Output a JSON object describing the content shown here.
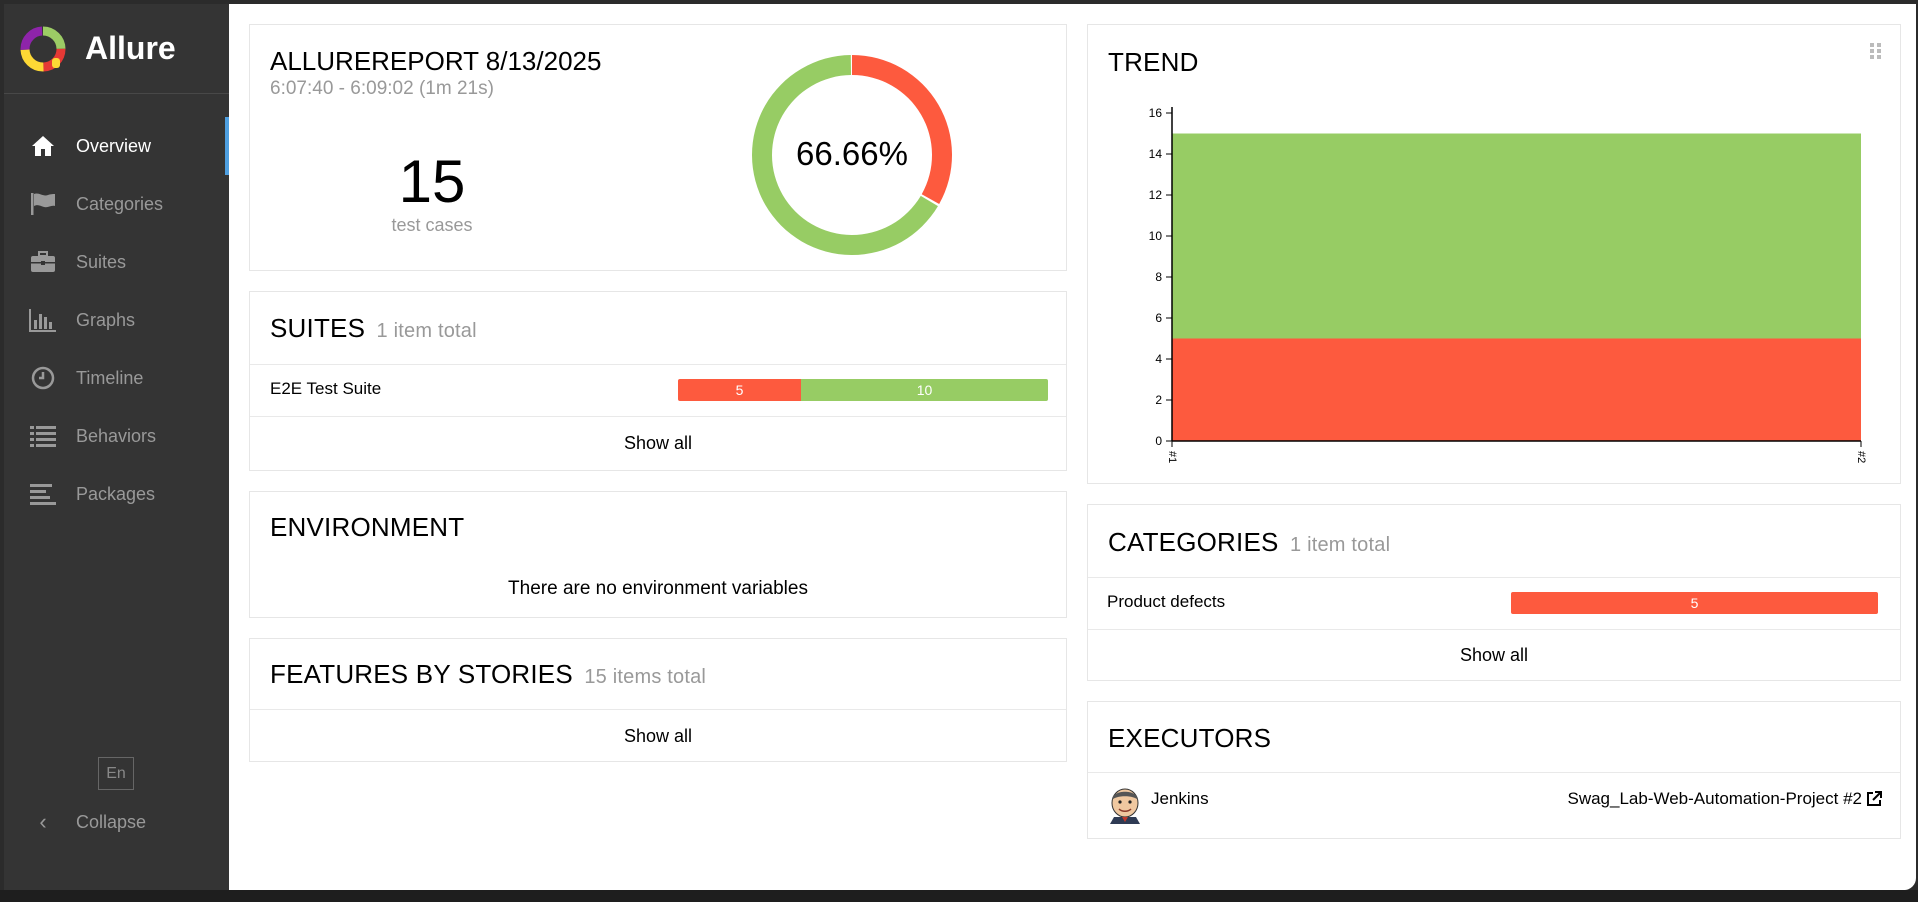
{
  "brand": {
    "name": "Allure"
  },
  "sidebar": {
    "items": [
      {
        "label": "Overview",
        "icon": "home-icon",
        "active": true
      },
      {
        "label": "Categories",
        "icon": "flag-icon",
        "active": false
      },
      {
        "label": "Suites",
        "icon": "briefcase-icon",
        "active": false
      },
      {
        "label": "Graphs",
        "icon": "bar-chart-icon",
        "active": false
      },
      {
        "label": "Timeline",
        "icon": "clock-icon",
        "active": false
      },
      {
        "label": "Behaviors",
        "icon": "list-icon",
        "active": false
      },
      {
        "label": "Packages",
        "icon": "align-left-icon",
        "active": false
      }
    ],
    "lang": "En",
    "collapse_label": "Collapse"
  },
  "summary": {
    "title": "ALLUREREPORT 8/13/2025",
    "time_range": "6:07:40 - 6:09:02 (1m 21s)",
    "count": "15",
    "count_label": "test cases",
    "percent": "66.66%",
    "passed_fraction": 0.6666,
    "colors": {
      "passed": "#97cc64",
      "failed": "#fd5a3e"
    }
  },
  "suites": {
    "title": "SUITES",
    "total": "1 item total",
    "rows": [
      {
        "name": "E2E Test Suite",
        "failed": "5",
        "passed": "10"
      }
    ],
    "show_all": "Show all"
  },
  "environment": {
    "title": "ENVIRONMENT",
    "empty_text": "There are no environment variables"
  },
  "features": {
    "title": "FEATURES BY STORIES",
    "total": "15 items total",
    "show_all": "Show all"
  },
  "trend": {
    "title": "TREND"
  },
  "chart_data": {
    "type": "area",
    "title": "",
    "xlabel": "",
    "ylabel": "",
    "x": [
      "#1",
      "#2"
    ],
    "series": [
      {
        "values": [
          5,
          5
        ],
        "color": "#fd5a3e"
      },
      {
        "values": [
          10,
          10
        ],
        "color": "#97cc64"
      }
    ],
    "stacked": true,
    "ylim": [
      0,
      16
    ],
    "yticks": [
      "0",
      "2",
      "4",
      "6",
      "8",
      "10",
      "12",
      "14",
      "16"
    ],
    "grid": false
  },
  "categories": {
    "title": "CATEGORIES",
    "total": "1 item total",
    "rows": [
      {
        "name": "Product defects",
        "value": "5"
      }
    ],
    "show_all": "Show all"
  },
  "executors": {
    "title": "EXECUTORS",
    "name": "Jenkins",
    "build": "Swag_Lab-Web-Automation-Project #2"
  }
}
